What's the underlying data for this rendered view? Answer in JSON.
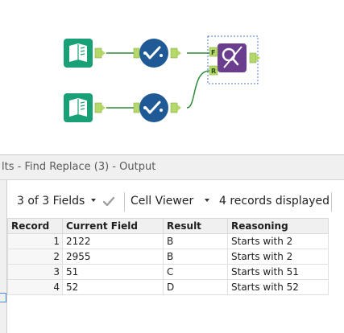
{
  "canvas": {
    "tools": [
      {
        "name": "input-data-tool-1"
      },
      {
        "name": "select-tool-1"
      },
      {
        "name": "input-data-tool-2"
      },
      {
        "name": "select-tool-2"
      },
      {
        "name": "find-replace-tool"
      }
    ],
    "anchors": {
      "find_replace_top": "F",
      "find_replace_bottom": "R"
    },
    "colors": {
      "input_tool": "#1aa077",
      "select_tool": "#1f5a96",
      "find_replace": "#6a3d8f",
      "connector": "#2e8b3a",
      "anchor": "#b5d86b"
    }
  },
  "results": {
    "title": "lts - Find Replace (3) - Output",
    "toolbar": {
      "fields_label": "3 of 3 Fields",
      "viewer_label": "Cell Viewer",
      "records_label": "4 records displayed"
    },
    "columns": [
      "Record",
      "Current Field",
      "Result",
      "Reasoning"
    ],
    "rows": [
      {
        "record": "1",
        "current_field": "2122",
        "result": "B",
        "reasoning": "Starts with 2"
      },
      {
        "record": "2",
        "current_field": "2955",
        "result": "B",
        "reasoning": "Starts with 2"
      },
      {
        "record": "3",
        "current_field": "51",
        "result": "C",
        "reasoning": "Starts with 51"
      },
      {
        "record": "4",
        "current_field": "52",
        "result": "D",
        "reasoning": "Starts with 52"
      }
    ]
  }
}
